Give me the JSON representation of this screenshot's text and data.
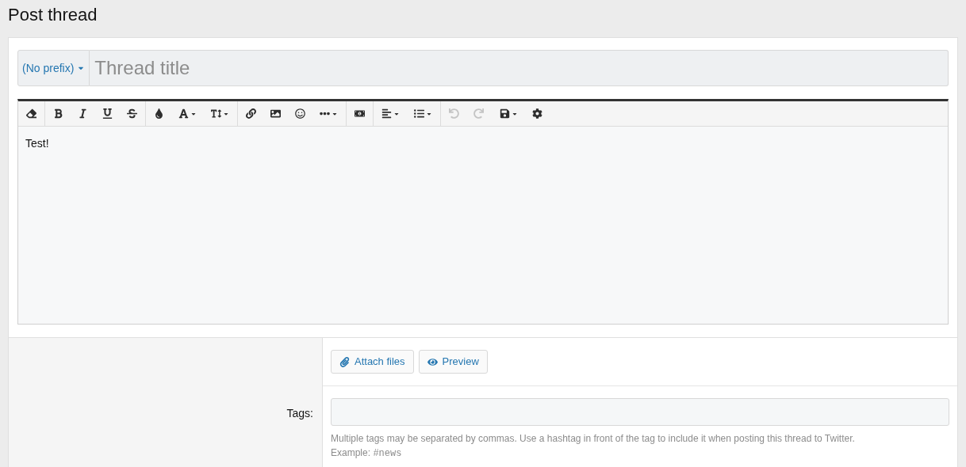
{
  "page_title": "Post thread",
  "title_row": {
    "prefix": "(No prefix)",
    "placeholder": "Thread title"
  },
  "toolbar": [
    [
      {
        "kind": "eraser",
        "dropdown": false,
        "disabled": false
      }
    ],
    [
      {
        "kind": "bold",
        "dropdown": false,
        "disabled": false
      },
      {
        "kind": "italic",
        "dropdown": false,
        "disabled": false
      },
      {
        "kind": "underline",
        "dropdown": false,
        "disabled": false
      },
      {
        "kind": "strike",
        "dropdown": false,
        "disabled": false
      }
    ],
    [
      {
        "kind": "color",
        "dropdown": false,
        "disabled": false
      },
      {
        "kind": "font",
        "dropdown": true,
        "disabled": false
      },
      {
        "kind": "size",
        "dropdown": true,
        "disabled": false
      }
    ],
    [
      {
        "kind": "link",
        "dropdown": false,
        "disabled": false
      },
      {
        "kind": "image",
        "dropdown": false,
        "disabled": false
      },
      {
        "kind": "smilie",
        "dropdown": false,
        "disabled": false
      },
      {
        "kind": "more",
        "dropdown": true,
        "disabled": false
      }
    ],
    [
      {
        "kind": "media",
        "dropdown": false,
        "disabled": false
      }
    ],
    [
      {
        "kind": "align",
        "dropdown": true,
        "disabled": false
      },
      {
        "kind": "list",
        "dropdown": true,
        "disabled": false
      }
    ],
    [
      {
        "kind": "undo",
        "dropdown": false,
        "disabled": true
      },
      {
        "kind": "redo",
        "dropdown": false,
        "disabled": true
      }
    ],
    [
      {
        "kind": "save",
        "dropdown": true,
        "disabled": false
      },
      {
        "kind": "settings",
        "dropdown": false,
        "disabled": false
      }
    ]
  ],
  "editor": {
    "value": "Test!"
  },
  "buttons": [
    {
      "kind": "attach",
      "label": "Attach files"
    },
    {
      "kind": "preview",
      "label": "Preview"
    }
  ],
  "tags": {
    "label": "Tags:",
    "hint": "Multiple tags may be separated by commas. Use a hashtag in front of the tag to include it when posting this thread to Twitter.",
    "example_label": "Example:",
    "example_code": "#news"
  }
}
